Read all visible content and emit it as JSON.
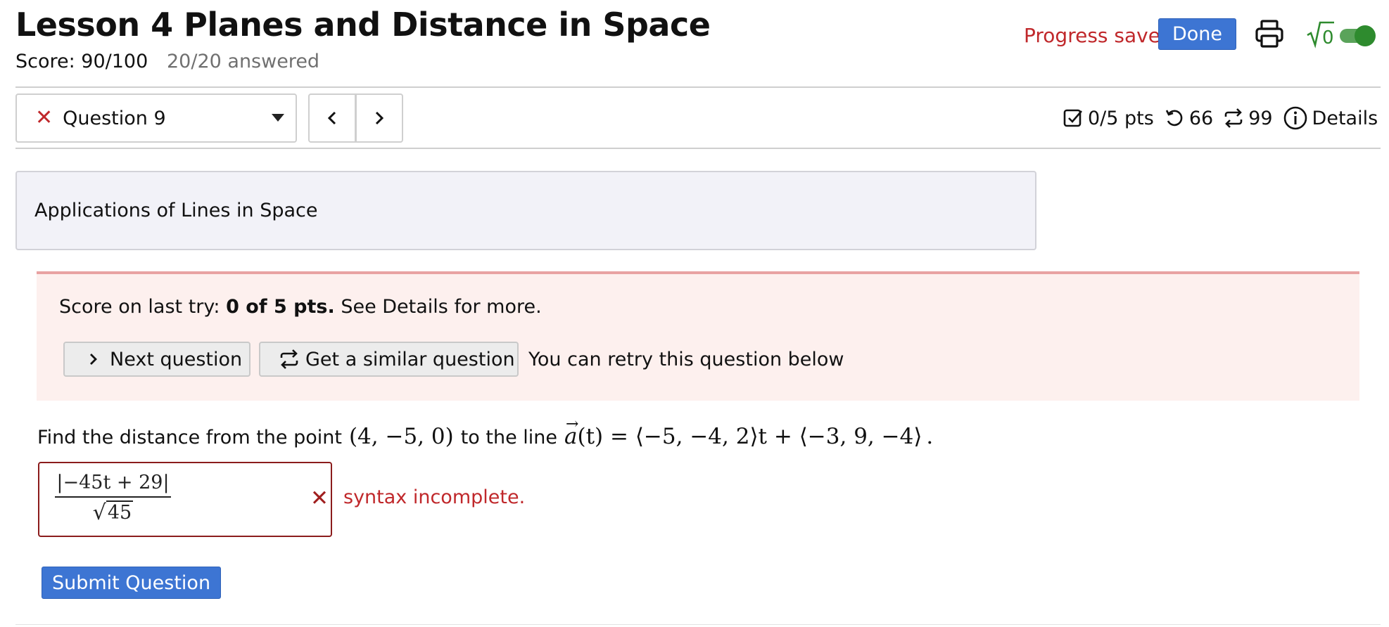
{
  "header": {
    "title": "Lesson 4 Planes and Distance in Space",
    "score": "Score: 90/100",
    "answered": "20/20 answered",
    "progress_saved": "Progress saved",
    "done_label": "Done",
    "toggle_label": "√0"
  },
  "question_nav": {
    "selected": "Question 9",
    "status_icon": "x-icon",
    "prev_icon": "chevron-left-icon",
    "next_icon": "chevron-right-icon"
  },
  "stats": {
    "points": "0/5 pts",
    "retries": "66",
    "versions": "99",
    "details_label": "Details"
  },
  "topic": "Applications of Lines in Space",
  "feedback": {
    "score_prefix": "Score on last try: ",
    "score_bold": "0 of 5 pts.",
    "score_suffix": " See Details for more.",
    "next_question_label": "Next question",
    "similar_label": "Get a similar question",
    "retry_text": "You can retry this question below"
  },
  "question": {
    "prefix": "Find the distance from the point",
    "point": "(4, −5, 0)",
    "middle": "to the line",
    "line_lhs": "(t) = ⟨−5, −4, 2⟩t + ⟨−3, 9, −4⟩",
    "line_var": "a",
    "period": "."
  },
  "answer": {
    "numerator": "|−45t + 29|",
    "denominator": "45",
    "error": "syntax incomplete."
  },
  "submit_label": "Submit Question",
  "colors": {
    "accent_blue": "#3d75d3",
    "error_red": "#c0282b",
    "feedback_bg": "#fdf0ee",
    "toggle_green": "#2e8b2e"
  }
}
